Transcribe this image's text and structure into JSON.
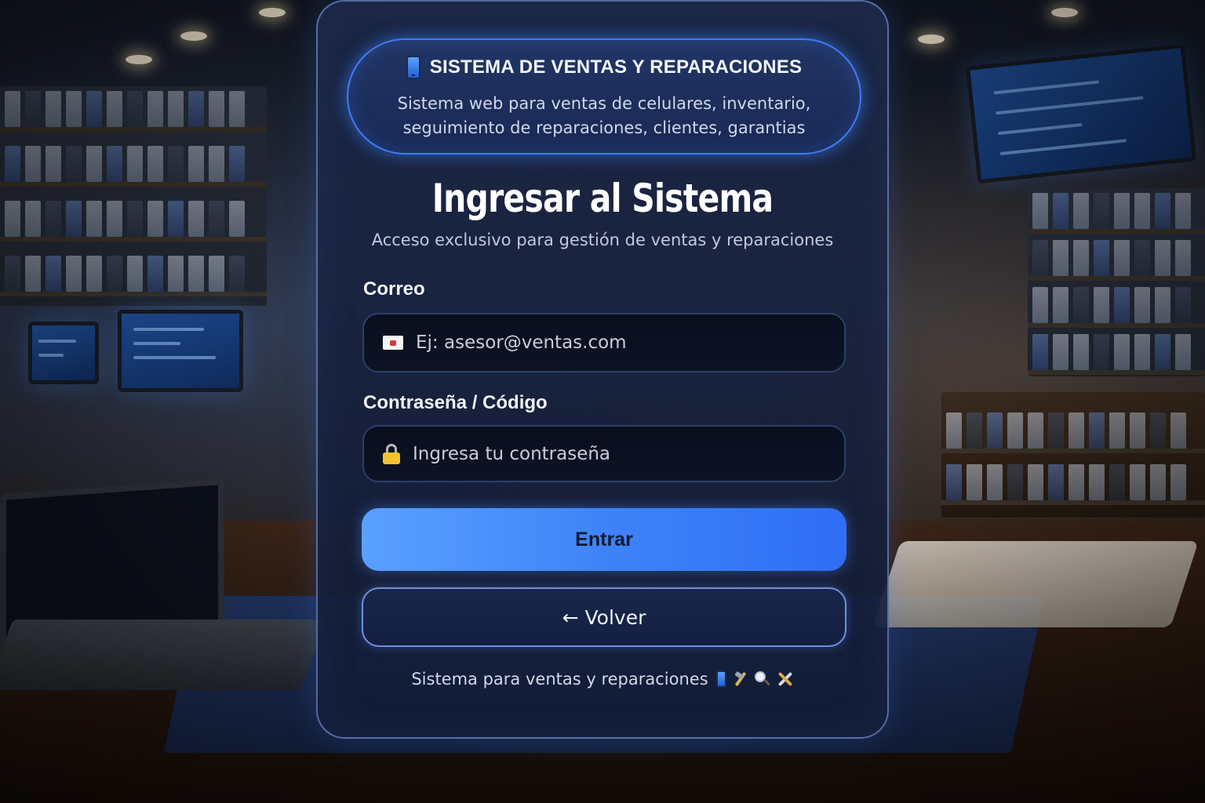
{
  "header": {
    "title": "SISTEMA DE VENTAS Y REPARACIONES",
    "description": "Sistema web para ventas de celulares, inventario, seguimiento de reparaciones, clientes, garantias"
  },
  "login": {
    "heading": "Ingresar al Sistema",
    "subheading": "Acceso exclusivo para gestión de ventas y reparaciones",
    "email_label": "Correo",
    "email_placeholder": "Ej: asesor@ventas.com",
    "password_label": "Contraseña / Código",
    "password_placeholder": "Ingresa tu contraseña",
    "submit_label": "Entrar",
    "back_label": "← Volver"
  },
  "footer": {
    "text": "Sistema para ventas y reparaciones"
  },
  "icons": {
    "header": "mobile-phone-icon",
    "email": "envelope-icon",
    "password": "lock-icon",
    "footer": [
      "mobile-phone-icon",
      "screwdriver-icon",
      "magnifier-icon",
      "wrench-hammer-icon"
    ]
  },
  "colors": {
    "accent": "#3f83f8",
    "accent_light": "#5aa0ff",
    "card_border": "#6c90e0",
    "text_primary": "#ffffff"
  }
}
